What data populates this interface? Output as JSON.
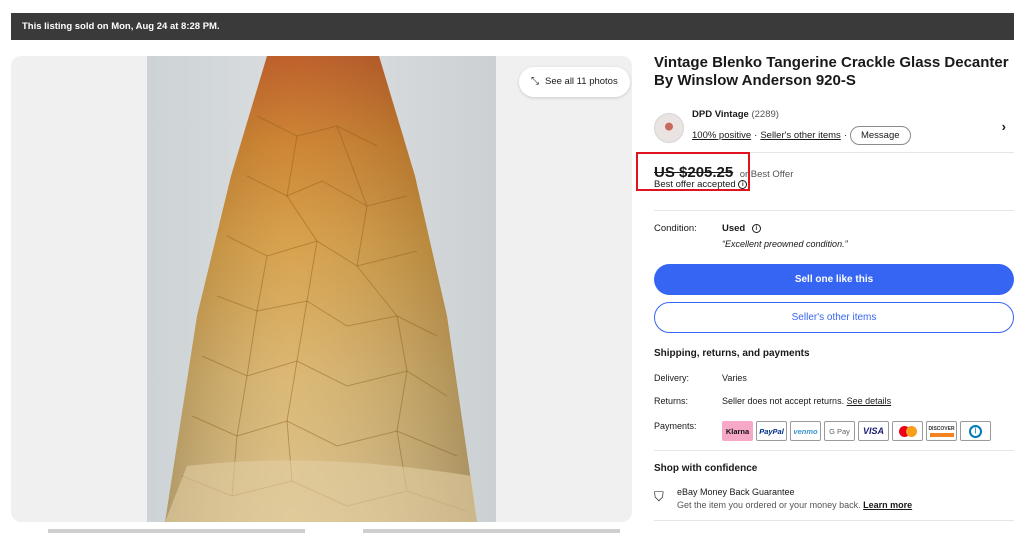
{
  "banner": {
    "text": "This listing sold on Mon, Aug 24 at 8:28 PM."
  },
  "gallery": {
    "see_all_label": "See all 11 photos",
    "expand_icon": "expand-arrows-icon"
  },
  "listing": {
    "title": "Vintage Blenko Tangerine Crackle Glass Decanter By Winslow Anderson 920-S"
  },
  "seller": {
    "name": "DPD Vintage",
    "feedback_count": "(2289)",
    "positive": "100% positive",
    "separator1": "·",
    "other_items_link": "Seller's other items",
    "separator2": "·",
    "message_label": "Message",
    "chevron_icon": "chevron-right-icon"
  },
  "price": {
    "amount": "US $205.25",
    "or_best_offer": "or Best Offer",
    "offer_status": "Best offer accepted",
    "highlight_color": "#e0141e"
  },
  "condition": {
    "label": "Condition:",
    "value": "Used",
    "quote": "“Excellent preowned condition.”"
  },
  "actions": {
    "primary_label": "Sell one like this",
    "secondary_label": "Seller's other items",
    "accent_color": "#3665f3"
  },
  "shipping": {
    "heading": "Shipping, returns, and payments",
    "delivery_label": "Delivery:",
    "delivery_value": "Varies",
    "returns_label": "Returns:",
    "returns_value": "Seller does not accept returns.",
    "returns_link": "See details",
    "payments_label": "Payments:",
    "payment_methods": [
      "Klarna",
      "PayPal",
      "venmo",
      "G Pay",
      "VISA",
      "Mastercard",
      "DISCOVER",
      "Diners Club"
    ]
  },
  "confidence": {
    "heading": "Shop with confidence",
    "guarantee_title": "eBay Money Back Guarantee",
    "guarantee_text": "Get the item you ordered or your money back.",
    "learn_more": "Learn more"
  }
}
